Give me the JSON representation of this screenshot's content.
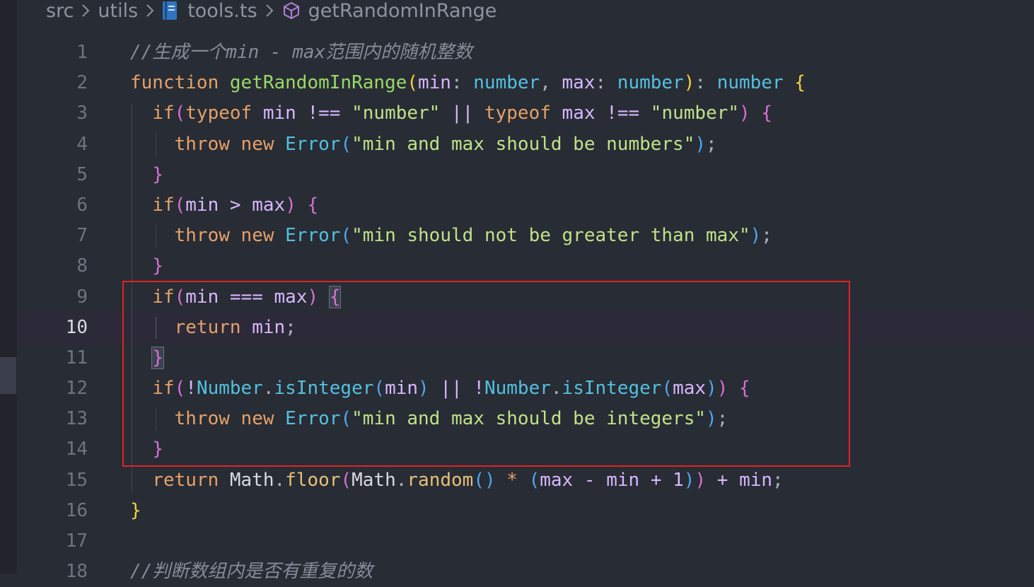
{
  "breadcrumb": {
    "items": [
      "src",
      "utils",
      "tools.ts",
      "getRandomInRange"
    ],
    "separator": ">",
    "icons": [
      "ts-file-icon",
      "symbol-function-icon"
    ]
  },
  "editor": {
    "current_line": 10,
    "lines": [
      {
        "n": "1",
        "tokens": [
          {
            "t": "//生成一个min - max范围内的随机整数",
            "c": "cmt"
          }
        ]
      },
      {
        "n": "2",
        "tokens": [
          {
            "t": "function ",
            "c": "kw"
          },
          {
            "t": "getRandomInRange",
            "c": "fn"
          },
          {
            "t": "(",
            "c": "b1"
          },
          {
            "t": "min",
            "c": "param"
          },
          {
            "t": ": ",
            "c": "punct"
          },
          {
            "t": "number",
            "c": "type"
          },
          {
            "t": ", ",
            "c": "punct"
          },
          {
            "t": "max",
            "c": "param"
          },
          {
            "t": ": ",
            "c": "punct"
          },
          {
            "t": "number",
            "c": "type"
          },
          {
            "t": ")",
            "c": "b1"
          },
          {
            "t": ": ",
            "c": "punct"
          },
          {
            "t": "number",
            "c": "type"
          },
          {
            "t": " ",
            "c": "punct"
          },
          {
            "t": "{",
            "c": "b1"
          }
        ]
      },
      {
        "n": "3",
        "tokens": [
          {
            "t": "  ",
            "c": "punct"
          },
          {
            "t": "if",
            "c": "kw"
          },
          {
            "t": "(",
            "c": "b2"
          },
          {
            "t": "typeof ",
            "c": "kw"
          },
          {
            "t": "min ",
            "c": "param"
          },
          {
            "t": "!== ",
            "c": "op"
          },
          {
            "t": "\"number\" ",
            "c": "str"
          },
          {
            "t": "|| ",
            "c": "op"
          },
          {
            "t": "typeof ",
            "c": "kw"
          },
          {
            "t": "max ",
            "c": "param"
          },
          {
            "t": "!== ",
            "c": "op"
          },
          {
            "t": "\"number\"",
            "c": "str"
          },
          {
            "t": ")",
            "c": "b2"
          },
          {
            "t": " ",
            "c": "punct"
          },
          {
            "t": "{",
            "c": "b2"
          }
        ]
      },
      {
        "n": "4",
        "tokens": [
          {
            "t": "    ",
            "c": "punct"
          },
          {
            "t": "throw ",
            "c": "kw"
          },
          {
            "t": "new ",
            "c": "kw"
          },
          {
            "t": "Error",
            "c": "type"
          },
          {
            "t": "(",
            "c": "b3"
          },
          {
            "t": "\"min and max should be numbers\"",
            "c": "str"
          },
          {
            "t": ")",
            "c": "b3"
          },
          {
            "t": ";",
            "c": "punct"
          }
        ]
      },
      {
        "n": "5",
        "tokens": [
          {
            "t": "  ",
            "c": "punct"
          },
          {
            "t": "}",
            "c": "b2"
          }
        ]
      },
      {
        "n": "6",
        "tokens": [
          {
            "t": "  ",
            "c": "punct"
          },
          {
            "t": "if",
            "c": "kw"
          },
          {
            "t": "(",
            "c": "b2"
          },
          {
            "t": "min ",
            "c": "param"
          },
          {
            "t": "> ",
            "c": "op"
          },
          {
            "t": "max",
            "c": "param"
          },
          {
            "t": ")",
            "c": "b2"
          },
          {
            "t": " ",
            "c": "punct"
          },
          {
            "t": "{",
            "c": "b2"
          }
        ]
      },
      {
        "n": "7",
        "tokens": [
          {
            "t": "    ",
            "c": "punct"
          },
          {
            "t": "throw ",
            "c": "kw"
          },
          {
            "t": "new ",
            "c": "kw"
          },
          {
            "t": "Error",
            "c": "type"
          },
          {
            "t": "(",
            "c": "b3"
          },
          {
            "t": "\"min should not be greater than max\"",
            "c": "str"
          },
          {
            "t": ")",
            "c": "b3"
          },
          {
            "t": ";",
            "c": "punct"
          }
        ]
      },
      {
        "n": "8",
        "tokens": [
          {
            "t": "  ",
            "c": "punct"
          },
          {
            "t": "}",
            "c": "b2"
          }
        ]
      },
      {
        "n": "9",
        "tokens": [
          {
            "t": "  ",
            "c": "punct"
          },
          {
            "t": "if",
            "c": "kw"
          },
          {
            "t": "(",
            "c": "b2"
          },
          {
            "t": "min ",
            "c": "param"
          },
          {
            "t": "=== ",
            "c": "op"
          },
          {
            "t": "max",
            "c": "param"
          },
          {
            "t": ")",
            "c": "b2"
          },
          {
            "t": " ",
            "c": "punct"
          },
          {
            "t": "{",
            "c": "b2",
            "box": true
          }
        ]
      },
      {
        "n": "10",
        "tokens": [
          {
            "t": "    ",
            "c": "punct"
          },
          {
            "t": "return ",
            "c": "kw"
          },
          {
            "t": "min",
            "c": "param"
          },
          {
            "t": ";",
            "c": "punct"
          }
        ]
      },
      {
        "n": "11",
        "tokens": [
          {
            "t": "  ",
            "c": "punct"
          },
          {
            "t": "}",
            "c": "b2",
            "box": true
          }
        ]
      },
      {
        "n": "12",
        "tokens": [
          {
            "t": "  ",
            "c": "punct"
          },
          {
            "t": "if",
            "c": "kw"
          },
          {
            "t": "(",
            "c": "b2"
          },
          {
            "t": "!",
            "c": "op"
          },
          {
            "t": "Number",
            "c": "type"
          },
          {
            "t": ".",
            "c": "punct"
          },
          {
            "t": "isInteger",
            "c": "type"
          },
          {
            "t": "(",
            "c": "b3"
          },
          {
            "t": "min",
            "c": "param"
          },
          {
            "t": ")",
            "c": "b3"
          },
          {
            "t": " ",
            "c": "punct"
          },
          {
            "t": "|| ",
            "c": "op"
          },
          {
            "t": "!",
            "c": "op"
          },
          {
            "t": "Number",
            "c": "type"
          },
          {
            "t": ".",
            "c": "punct"
          },
          {
            "t": "isInteger",
            "c": "type"
          },
          {
            "t": "(",
            "c": "b3"
          },
          {
            "t": "max",
            "c": "param"
          },
          {
            "t": ")",
            "c": "b3"
          },
          {
            "t": ")",
            "c": "b2"
          },
          {
            "t": " ",
            "c": "punct"
          },
          {
            "t": "{",
            "c": "b2"
          }
        ]
      },
      {
        "n": "13",
        "tokens": [
          {
            "t": "    ",
            "c": "punct"
          },
          {
            "t": "throw ",
            "c": "kw"
          },
          {
            "t": "new ",
            "c": "kw"
          },
          {
            "t": "Error",
            "c": "type"
          },
          {
            "t": "(",
            "c": "b3"
          },
          {
            "t": "\"min and max should be integers\"",
            "c": "str"
          },
          {
            "t": ")",
            "c": "b3"
          },
          {
            "t": ";",
            "c": "punct"
          }
        ]
      },
      {
        "n": "14",
        "tokens": [
          {
            "t": "  ",
            "c": "punct"
          },
          {
            "t": "}",
            "c": "b2"
          }
        ]
      },
      {
        "n": "15",
        "tokens": [
          {
            "t": "  ",
            "c": "punct"
          },
          {
            "t": "return ",
            "c": "kw"
          },
          {
            "t": "Math",
            "c": "obj"
          },
          {
            "t": ".",
            "c": "punct"
          },
          {
            "t": "floor",
            "c": "method"
          },
          {
            "t": "(",
            "c": "b2"
          },
          {
            "t": "Math",
            "c": "obj"
          },
          {
            "t": ".",
            "c": "punct"
          },
          {
            "t": "random",
            "c": "method"
          },
          {
            "t": "()",
            "c": "b3"
          },
          {
            "t": " * ",
            "c": "kw"
          },
          {
            "t": "(",
            "c": "b3"
          },
          {
            "t": "max ",
            "c": "param"
          },
          {
            "t": "- ",
            "c": "op"
          },
          {
            "t": "min ",
            "c": "param"
          },
          {
            "t": "+ ",
            "c": "op"
          },
          {
            "t": "1",
            "c": "num"
          },
          {
            "t": ")",
            "c": "b3"
          },
          {
            "t": ")",
            "c": "b2"
          },
          {
            "t": " + ",
            "c": "op"
          },
          {
            "t": "min",
            "c": "param"
          },
          {
            "t": ";",
            "c": "punct"
          }
        ]
      },
      {
        "n": "16",
        "tokens": [
          {
            "t": "}",
            "c": "b1"
          }
        ]
      },
      {
        "n": "17",
        "tokens": []
      },
      {
        "n": "18",
        "tokens": [
          {
            "t": "//判断数组内是否有重复的数",
            "c": "cmt"
          }
        ]
      }
    ]
  },
  "colors": {
    "background": "#282c34",
    "highlight_box": "#e02424",
    "current_line": "#2c2a38"
  }
}
